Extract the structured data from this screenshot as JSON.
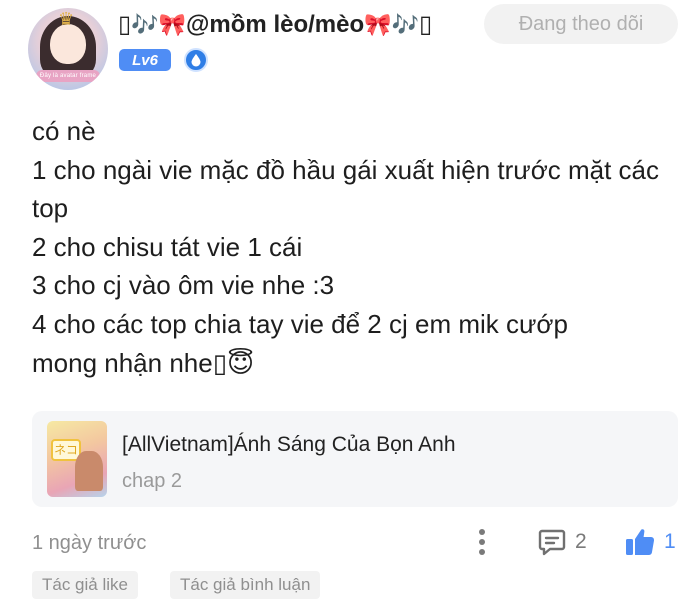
{
  "header": {
    "avatar_frame_text": "Đây là avatar frame",
    "username": {
      "prefix": "▯",
      "note_1": "🎶",
      "ribbon_1": "🎀",
      "name": "@mồm lèo/mèo",
      "ribbon_2": "🎀",
      "note_2": "🎶",
      "suffix": "▯"
    },
    "follow_label": "Đang theo dõi",
    "level_label": "Lv6",
    "rank_icon": "droplet-badge-icon"
  },
  "comment": {
    "lines": [
      "có nè",
      "1 cho ngài vie mặc đồ hầu gái xuất hiện trước mặt các top",
      "2 cho chisu tát vie 1 cái",
      "3 cho cj vào ôm vie nhe :3",
      "4 cho các top chia tay vie để 2 cj em mik cướp",
      "mong nhận nhe"
    ],
    "last_line_glyph": "▯",
    "last_line_emoji": "😇"
  },
  "story": {
    "title": "[AllVietnam]Ánh Sáng Của Bọn Anh",
    "chapter": "chap 2",
    "cover_tag": "ネコ"
  },
  "footer": {
    "time": "1 ngày trước",
    "comment_count": "2",
    "like_count": "1",
    "tags": [
      "Tác giả like",
      "Tác giả bình luận"
    ]
  },
  "colors": {
    "accent": "#4f8df5",
    "muted_text": "#8f8f8f",
    "pill_bg": "#f2f2f2"
  }
}
